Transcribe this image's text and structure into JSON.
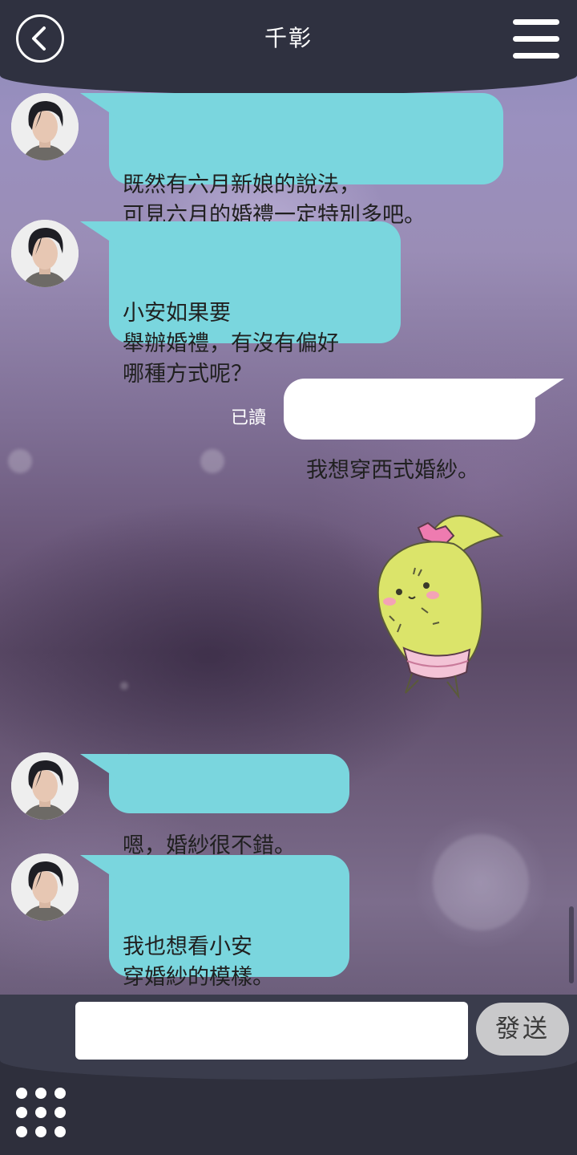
{
  "header": {
    "title": "千彰",
    "back_icon": "chevron-left-icon",
    "menu_icon": "hamburger-menu-icon"
  },
  "messages": [
    {
      "sender": "contact",
      "text": "既然有六月新娘的說法，\n可見六月的婚禮一定特別多吧。"
    },
    {
      "sender": "contact",
      "text": "小安如果要\n舉辦婚禮，有沒有偏好\n哪種方式呢？"
    },
    {
      "sender": "me",
      "text": "我想穿西式婚紗。",
      "status": "已讀"
    },
    {
      "sender": "me",
      "type": "sticker",
      "sticker": "cactus-sticker"
    },
    {
      "sender": "contact",
      "text": "嗯，婚紗很不錯。"
    },
    {
      "sender": "contact",
      "text": "我也想看小安\n穿婚紗的模樣。\n……一定很漂亮。"
    }
  ],
  "composer": {
    "input_value": "",
    "input_placeholder": "",
    "send_label": "發送"
  },
  "footer": {
    "grid_icon": "app-grid-icon"
  },
  "colors": {
    "contact_bubble": "#7ad6de",
    "my_bubble": "#ffffff",
    "header_bg": "#2f3140",
    "send_button": "#c9c9cb"
  }
}
